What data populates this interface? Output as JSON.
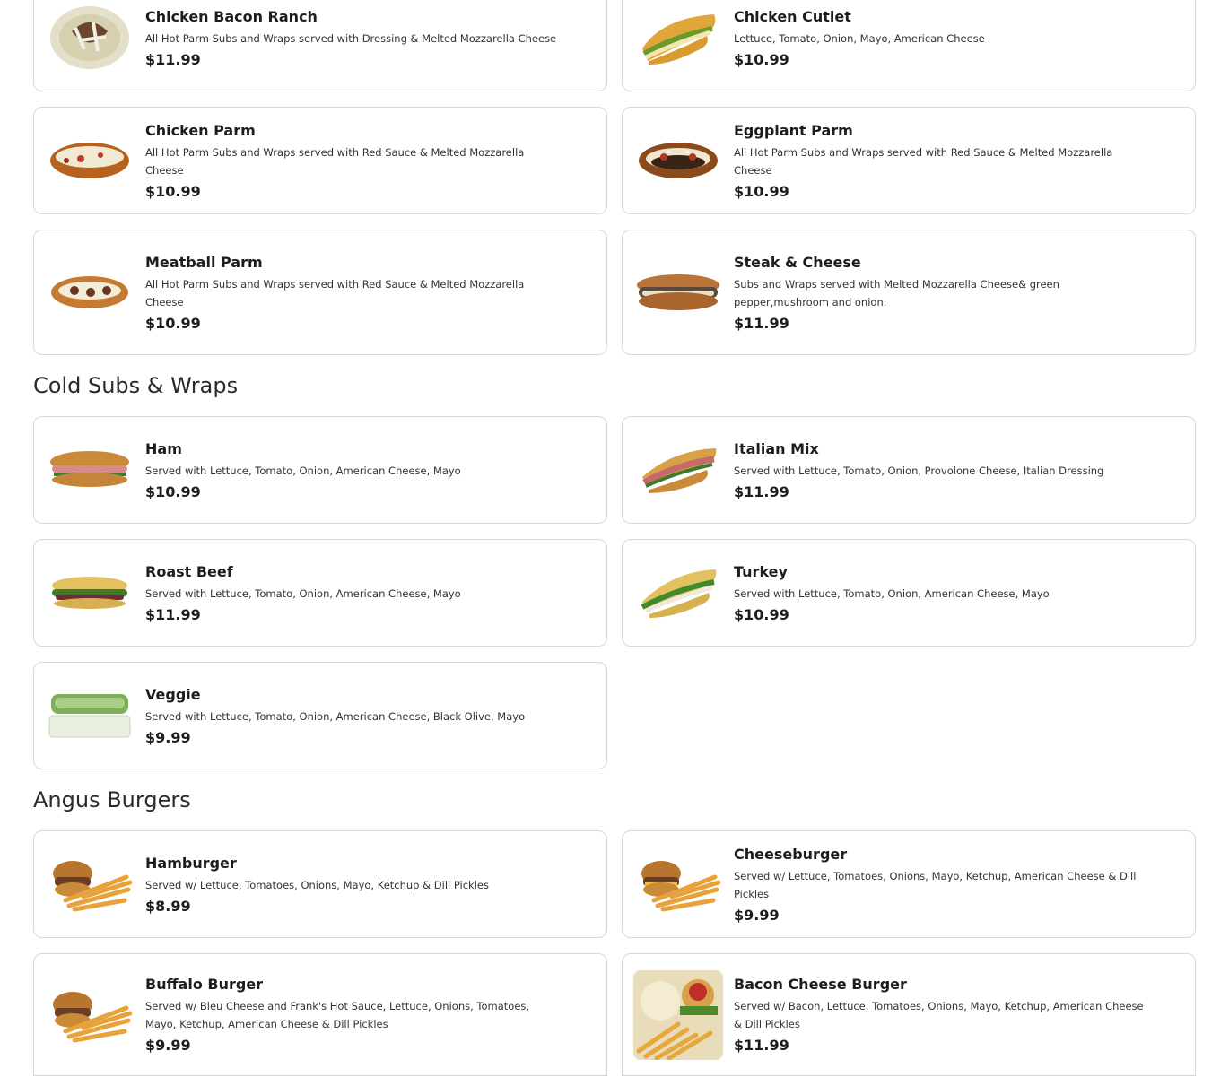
{
  "sections": [
    {
      "title": "",
      "items": [
        {
          "name": "Chicken Bacon Ranch",
          "desc": "All Hot Parm Subs and Wraps served with Dressing & Melted Mozzarella Cheese",
          "price": "$11.99",
          "icon": "wrap-icon"
        },
        {
          "name": "Chicken Cutlet",
          "desc": "Lettuce, Tomato, Onion, Mayo, American Cheese",
          "price": "$10.99",
          "icon": "sub-icon"
        },
        {
          "name": "Chicken Parm",
          "desc": "All Hot Parm Subs and Wraps served with Red Sauce & Melted Mozzarella Cheese",
          "price": "$10.99",
          "icon": "parm-sub-icon"
        },
        {
          "name": "Eggplant Parm",
          "desc": "All Hot Parm Subs and Wraps served with Red Sauce & Melted Mozzarella Cheese",
          "price": "$10.99",
          "icon": "parm-sub-icon"
        },
        {
          "name": "Meatball Parm",
          "desc": "All Hot Parm Subs and Wraps served with Red Sauce & Melted Mozzarella Cheese",
          "price": "$10.99",
          "icon": "parm-sub-icon"
        },
        {
          "name": "Steak & Cheese",
          "desc": "Subs and Wraps served with  Melted Mozzarella Cheese& green pepper,mushroom and onion.",
          "price": "$11.99",
          "icon": "steak-sub-icon"
        }
      ]
    },
    {
      "title": "Cold Subs & Wraps",
      "items": [
        {
          "name": "Ham",
          "desc": "Served with Lettuce, Tomato, Onion, American Cheese, Mayo",
          "price": "$10.99",
          "icon": "cold-sub-icon"
        },
        {
          "name": "Italian Mix",
          "desc": "Served with Lettuce, Tomato, Onion, Provolone Cheese, Italian Dressing",
          "price": "$11.99",
          "icon": "cold-sub-icon"
        },
        {
          "name": "Roast Beef",
          "desc": "Served with Lettuce, Tomato, Onion, American Cheese, Mayo",
          "price": "$11.99",
          "icon": "cold-sub-icon"
        },
        {
          "name": "Turkey",
          "desc": "Served with Lettuce, Tomato, Onion, American Cheese, Mayo",
          "price": "$10.99",
          "icon": "cold-sub-icon"
        },
        {
          "name": "Veggie",
          "desc": "Served with Lettuce, Tomato, Onion, American Cheese, Black Olive, Mayo",
          "price": "$9.99",
          "icon": "veggie-sub-icon"
        }
      ]
    },
    {
      "title": "Angus Burgers",
      "items": [
        {
          "name": "Hamburger",
          "desc": "Served w/ Lettuce, Tomatoes, Onions, Mayo, Ketchup & Dill Pickles",
          "price": "$8.99",
          "icon": "burger-fries-icon"
        },
        {
          "name": "Cheeseburger",
          "desc": "Served w/ Lettuce, Tomatoes, Onions, Mayo, Ketchup, American Cheese & Dill Pickles",
          "price": "$9.99",
          "icon": "burger-fries-icon"
        },
        {
          "name": "Buffalo Burger",
          "desc": "Served w/ Bleu Cheese and Frank's Hot Sauce, Lettuce, Onions, Tomatoes, Mayo, Ketchup, American Cheese & Dill Pickles",
          "price": "$9.99",
          "icon": "burger-fries-icon"
        },
        {
          "name": "Bacon Cheese Burger",
          "desc": "Served w/ Bacon, Lettuce, Tomatoes, Onions, Mayo, Ketchup, American Cheese & Dill Pickles",
          "price": "$11.99",
          "icon": "burger-plate-icon"
        }
      ]
    }
  ]
}
